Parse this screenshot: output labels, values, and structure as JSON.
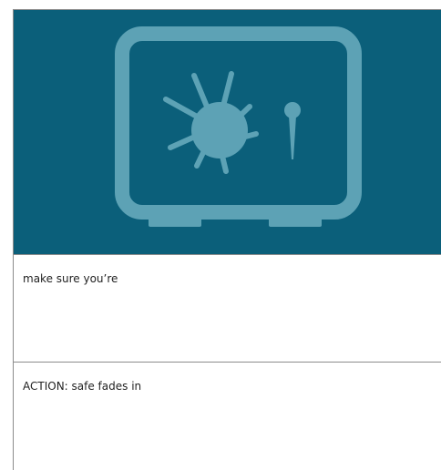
{
  "storyboard": {
    "panel": {
      "background_color": "#0b5f7a",
      "illustration_color": "#5da2b5",
      "icon": "safe-icon"
    },
    "dialog_text": "make sure you’re",
    "action_text": "ACTION: safe fades in"
  }
}
